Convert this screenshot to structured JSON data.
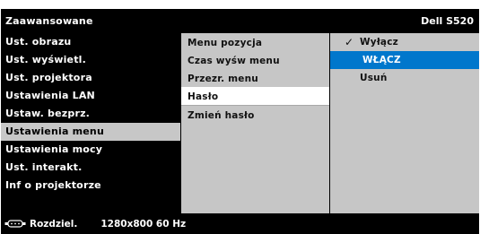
{
  "header": {
    "title": "Zaawansowane",
    "model": "Dell S520"
  },
  "main_menu": {
    "items": [
      {
        "label": "Ust. obrazu",
        "selected": false
      },
      {
        "label": "Ust. wyświetl.",
        "selected": false
      },
      {
        "label": "Ust. projektora",
        "selected": false
      },
      {
        "label": "Ustawienia LAN",
        "selected": false
      },
      {
        "label": "Ustaw. bezprz.",
        "selected": false
      },
      {
        "label": "Ustawienia menu",
        "selected": true
      },
      {
        "label": "Ustawienia mocy",
        "selected": false
      },
      {
        "label": "Ust. interakt.",
        "selected": false
      },
      {
        "label": "Inf o projektorze",
        "selected": false
      }
    ]
  },
  "submenu": {
    "items": [
      {
        "label": "Menu pozycja",
        "selected": false
      },
      {
        "label": "Czas wyśw menu",
        "selected": false
      },
      {
        "label": "Przezr. menu",
        "selected": false
      },
      {
        "label": "Hasło",
        "selected": true
      },
      {
        "label": "Zmień hasło",
        "selected": false
      }
    ]
  },
  "options": {
    "items": [
      {
        "label": "Wyłącz",
        "checked": true,
        "highlighted": false
      },
      {
        "label": "WŁĄCZ",
        "checked": false,
        "highlighted": true
      },
      {
        "label": "Usuń",
        "checked": false,
        "highlighted": false
      }
    ],
    "check_symbol": "✓",
    "highlight_color": "#0077cc"
  },
  "footer": {
    "icon": "display-connector-icon",
    "label": "Rozdziel.",
    "value": "1280x800 60 Hz"
  }
}
